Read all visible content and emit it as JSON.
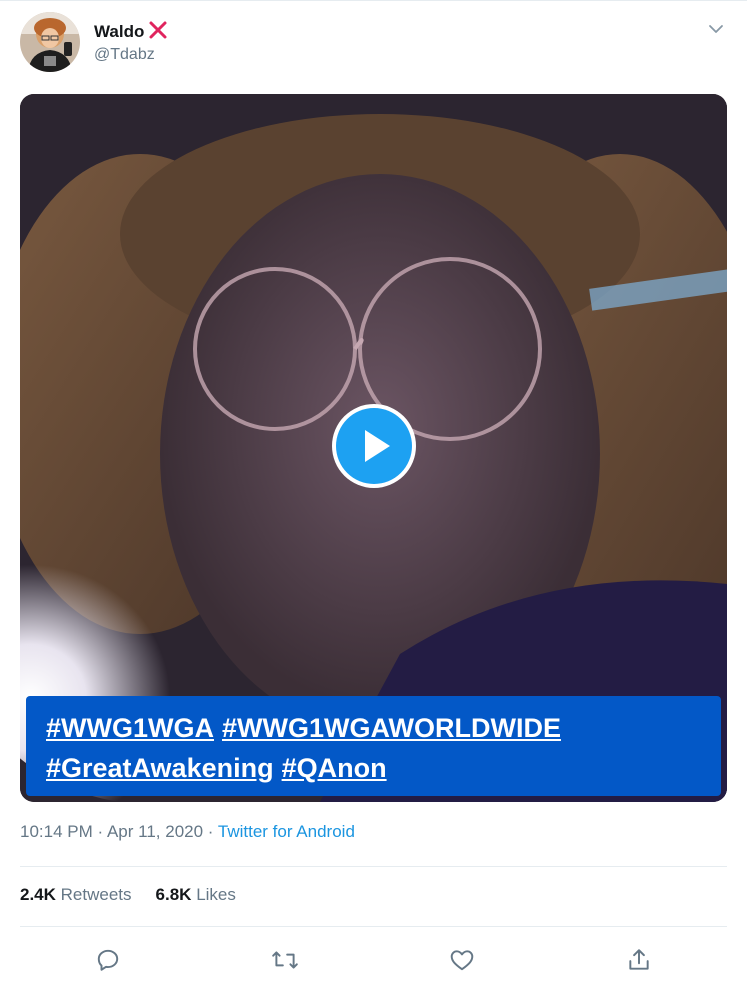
{
  "author": {
    "name": "Waldo",
    "badge_icon": "red-x-icon",
    "handle": "@Tdabz"
  },
  "media": {
    "type": "video",
    "caption_tags": [
      "#WWG1WGA",
      "#WWG1WGAWORLDWIDE",
      "#GreatAwakening",
      "#QAnon"
    ],
    "caption_color": "#0358c7",
    "play_color": "#1da1f2"
  },
  "meta": {
    "time": "10:14 PM",
    "sep1": "·",
    "date": "Apr 11, 2020",
    "sep2": "·",
    "source": "Twitter for Android"
  },
  "stats": {
    "retweets_count": "2.4K",
    "retweets_label": "Retweets",
    "likes_count": "6.8K",
    "likes_label": "Likes"
  },
  "actions": [
    "reply-icon",
    "retweet-icon",
    "like-icon",
    "share-icon"
  ]
}
